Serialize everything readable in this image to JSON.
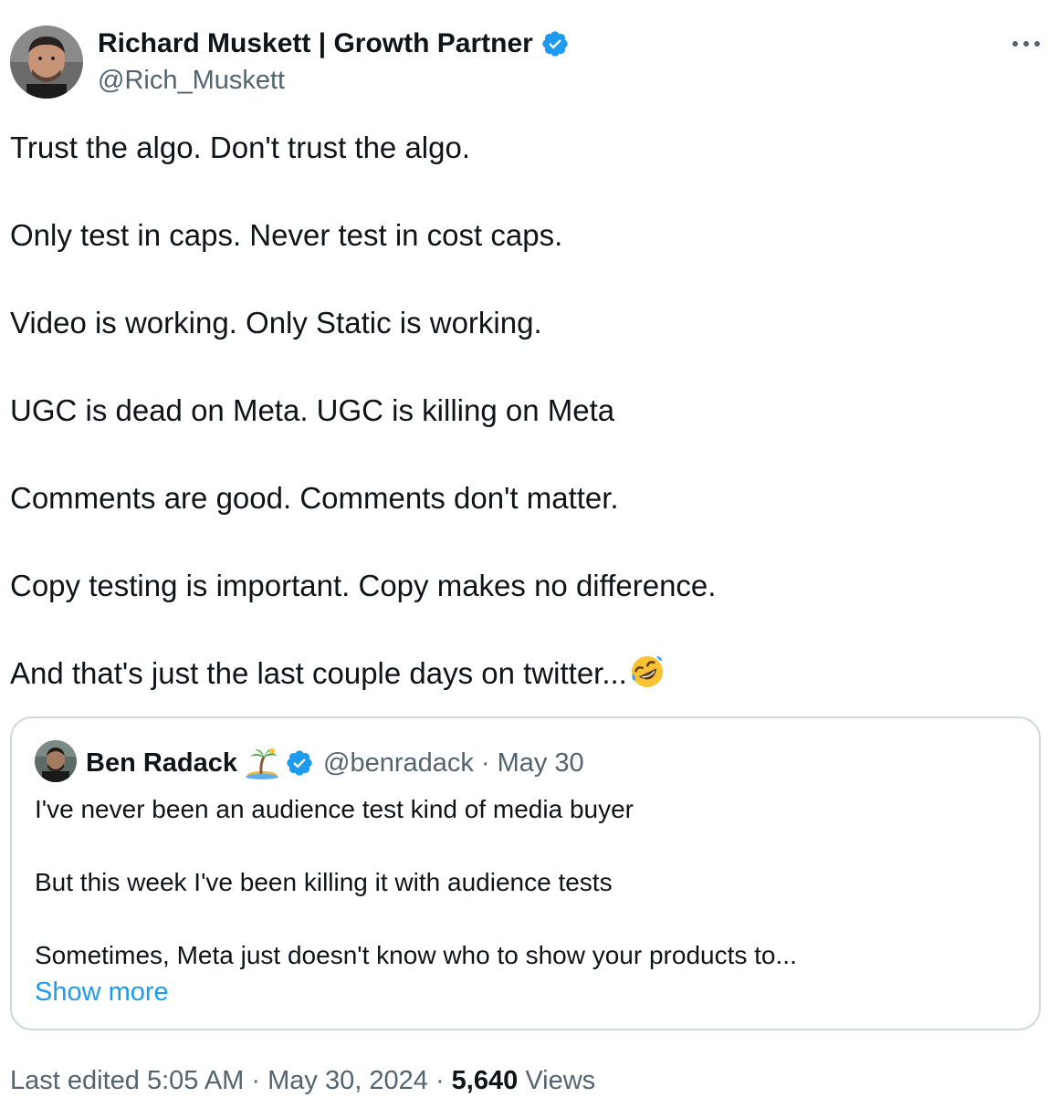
{
  "author": {
    "name": "Richard Muskett | Growth Partner",
    "handle": "@Rich_Muskett",
    "verified": true
  },
  "tweet": {
    "lines": [
      "Trust the algo. Don't trust the algo.",
      "Only test in caps. Never test in cost caps.",
      "Video is working. Only Static is working.",
      "UGC is dead on Meta. UGC is killing on Meta",
      "Comments are good. Comments don't matter.",
      "Copy testing is important. Copy makes no difference.",
      "And that's just the last couple days on twitter..."
    ],
    "trailing_emoji": "rofl-emoji"
  },
  "quote": {
    "name": "Ben Radack",
    "name_emoji": "desert-island-emoji",
    "verified": true,
    "handle": "@benradack",
    "separator": "·",
    "date": "May 30",
    "lines": [
      "I've never been an audience test kind of media buyer",
      "But this week I've been killing it with audience tests",
      "Sometimes, Meta just doesn't know who to show your products to..."
    ],
    "show_more_label": "Show more"
  },
  "meta": {
    "edited_label": "Last edited 5:05 AM",
    "separator": "·",
    "date": "May 30, 2024",
    "views_count": "5,640",
    "views_label": "Views"
  },
  "colors": {
    "text": "#0f1419",
    "secondary": "#536471",
    "link": "#1d9bf0",
    "verified": "#1d9bf0",
    "border": "#cfd9de"
  }
}
